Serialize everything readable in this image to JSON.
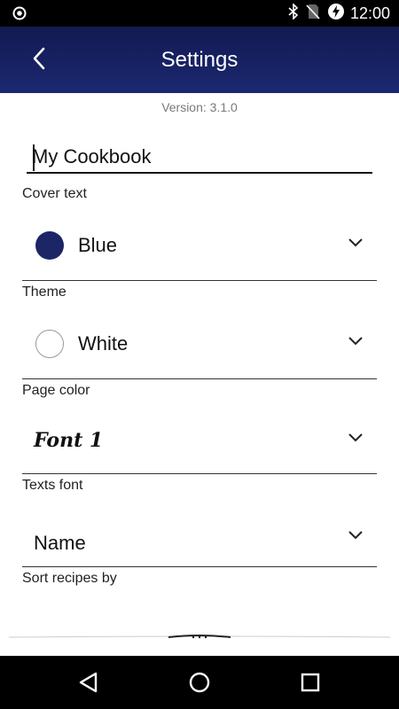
{
  "status_bar": {
    "time": "12:00",
    "icons": [
      "record-icon",
      "bluetooth-icon",
      "no-sim-icon",
      "battery-charging-icon"
    ]
  },
  "app_bar": {
    "title": "Settings",
    "back_icon": "chevron-left-icon"
  },
  "version_text": "Version: 3.1.0",
  "cover": {
    "value": "My Cookbook",
    "label": "Cover text"
  },
  "theme": {
    "value": "Blue",
    "label": "Theme",
    "swatch_color": "#1c2565"
  },
  "page_color": {
    "value": "White",
    "label": "Page color",
    "swatch_color": "#ffffff"
  },
  "texts_font": {
    "value": "Font 1",
    "label": "Texts font"
  },
  "sort": {
    "value": "Name",
    "label": "Sort recipes by"
  },
  "nav_bar": {
    "icons": [
      "back-triangle-icon",
      "home-circle-icon",
      "recents-square-icon"
    ]
  },
  "colors": {
    "app_bar_top": "#121a52",
    "app_bar_bottom": "#1c2870"
  }
}
